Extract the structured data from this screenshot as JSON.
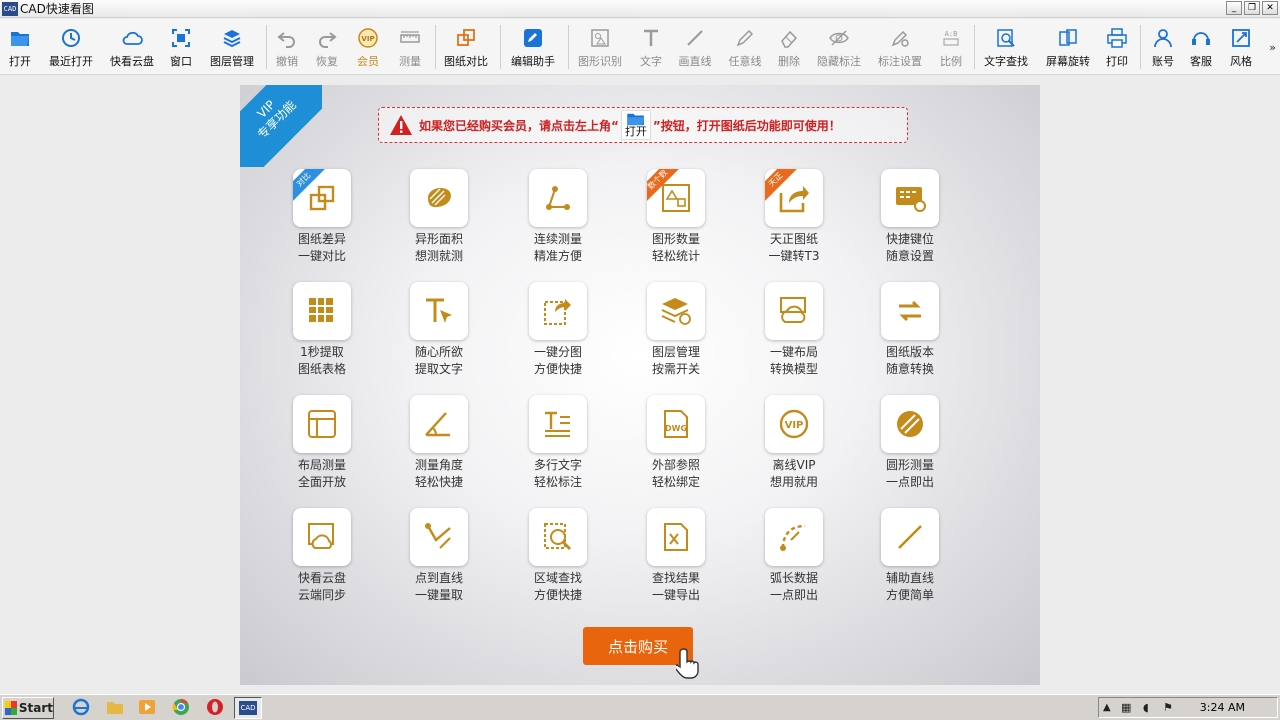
{
  "window": {
    "title": "CAD快速看图",
    "app_icon_text": "CAD"
  },
  "toolbar": {
    "items": [
      {
        "label": "打开",
        "icon": "folder-open-icon"
      },
      {
        "label": "最近打开",
        "icon": "history-icon"
      },
      {
        "label": "快看云盘",
        "icon": "cloud-icon"
      },
      {
        "label": "窗口",
        "icon": "window-icon"
      },
      {
        "label": "图层管理",
        "icon": "layers-icon"
      },
      {
        "label": "撤销",
        "icon": "undo-icon"
      },
      {
        "label": "恢复",
        "icon": "redo-icon"
      },
      {
        "label": "会员",
        "icon": "vip-icon"
      },
      {
        "label": "测量",
        "icon": "ruler-icon"
      },
      {
        "label": "图纸对比",
        "icon": "compare-icon"
      },
      {
        "label": "编辑助手",
        "icon": "edit-assistant-icon"
      },
      {
        "label": "图形识别",
        "icon": "shape-recognition-icon"
      },
      {
        "label": "文字",
        "icon": "text-icon"
      },
      {
        "label": "画直线",
        "icon": "line-icon"
      },
      {
        "label": "任意线",
        "icon": "pen-icon"
      },
      {
        "label": "删除",
        "icon": "eraser-icon"
      },
      {
        "label": "隐藏标注",
        "icon": "hide-icon"
      },
      {
        "label": "标注设置",
        "icon": "annotation-settings-icon"
      },
      {
        "label": "比例",
        "icon": "scale-icon"
      },
      {
        "label": "文字查找",
        "icon": "text-search-icon"
      },
      {
        "label": "屏幕旋转",
        "icon": "rotate-screen-icon"
      },
      {
        "label": "打印",
        "icon": "print-icon"
      },
      {
        "label": "账号",
        "icon": "user-icon"
      },
      {
        "label": "客服",
        "icon": "headset-icon"
      },
      {
        "label": "风格",
        "icon": "style-icon"
      }
    ],
    "more": "»"
  },
  "vip_panel": {
    "ribbon": [
      "VIP",
      "专享功能"
    ],
    "notice_before": "如果您已经购买会员，请点击左上角“",
    "notice_open": "打开",
    "notice_after": "”按钮，打开图纸后功能即可使用！",
    "features": [
      {
        "l1": "图纸差异",
        "l2": "一键对比",
        "badge": "对比",
        "badge_color": "#2c8fe0",
        "icon": "compare-icon"
      },
      {
        "l1": "异形面积",
        "l2": "想测就测",
        "icon": "irregular-area-icon"
      },
      {
        "l1": "连续测量",
        "l2": "精准方便",
        "icon": "continuous-measure-icon"
      },
      {
        "l1": "图形数量",
        "l2": "轻松统计",
        "badge": "数个数",
        "badge_color": "#e96a1c",
        "icon": "shape-count-icon"
      },
      {
        "l1": "天正图纸",
        "l2": "一键转T3",
        "badge": "天正",
        "badge_color": "#e96a1c",
        "icon": "export-icon"
      },
      {
        "l1": "快捷键位",
        "l2": "随意设置",
        "icon": "keyboard-settings-icon"
      },
      {
        "l1": "1秒提取",
        "l2": "图纸表格",
        "icon": "table-extract-icon"
      },
      {
        "l1": "随心所欲",
        "l2": "提取文字",
        "icon": "text-extract-icon"
      },
      {
        "l1": "一键分图",
        "l2": "方便快捷",
        "icon": "split-drawing-icon"
      },
      {
        "l1": "图层管理",
        "l2": "按需开关",
        "icon": "layer-toggle-icon"
      },
      {
        "l1": "一键布局",
        "l2": "转换模型",
        "icon": "layout-convert-icon"
      },
      {
        "l1": "图纸版本",
        "l2": "随意转换",
        "icon": "version-convert-icon"
      },
      {
        "l1": "布局测量",
        "l2": "全面开放",
        "icon": "layout-measure-icon"
      },
      {
        "l1": "测量角度",
        "l2": "轻松快捷",
        "icon": "angle-measure-icon"
      },
      {
        "l1": "多行文字",
        "l2": "轻松标注",
        "icon": "multiline-text-icon"
      },
      {
        "l1": "外部参照",
        "l2": "轻松绑定",
        "icon": "dwg-reference-icon"
      },
      {
        "l1": "离线VIP",
        "l2": "想用就用",
        "icon": "offline-vip-icon"
      },
      {
        "l1": "圆形测量",
        "l2": "一点即出",
        "icon": "circle-measure-icon"
      },
      {
        "l1": "快看云盘",
        "l2": "云端同步",
        "icon": "cloud-sync-icon"
      },
      {
        "l1": "点到直线",
        "l2": "一键量取",
        "icon": "point-line-icon"
      },
      {
        "l1": "区域查找",
        "l2": "方便快捷",
        "icon": "area-search-icon"
      },
      {
        "l1": "查找结果",
        "l2": "一键导出",
        "icon": "export-excel-icon"
      },
      {
        "l1": "弧长数据",
        "l2": "一点即出",
        "icon": "arc-length-icon"
      },
      {
        "l1": "辅助直线",
        "l2": "方便简单",
        "icon": "aux-line-icon"
      }
    ],
    "buy_button": "点击购买"
  },
  "watermark": "ANY RUN",
  "taskbar": {
    "start_label": "Start",
    "clock": "3:24 AM"
  },
  "colors": {
    "accent_gold": "#c48a1a",
    "ribbon_blue": "#1e8fd6",
    "buy_orange": "#e8650e",
    "notice_red": "#d02020"
  }
}
